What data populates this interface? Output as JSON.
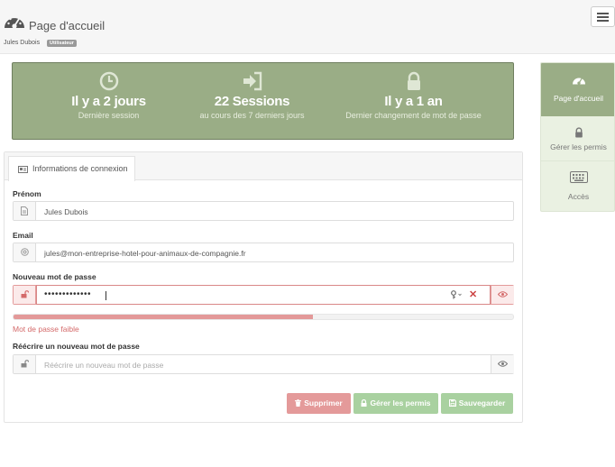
{
  "header": {
    "title": "Page d'accueil",
    "user_name": "Jules Dubois",
    "role_badge": "Utilisateur",
    "logo_icon": "dashboard-gauge-icon",
    "menu_icon": "hamburger-menu-icon"
  },
  "stats": [
    {
      "icon": "clock-icon",
      "value": "Il y a 2 jours",
      "caption": "Dernière session"
    },
    {
      "icon": "sign-in-icon",
      "value": "22 Sessions",
      "caption": "au cours des 7 derniers jours"
    },
    {
      "icon": "lock-icon",
      "value": "Il y a 1 an",
      "caption": "Dernier changement de mot de passe"
    }
  ],
  "sidebar": {
    "items": [
      {
        "label": "Page d'accueil",
        "icon": "dashboard-icon",
        "active": true
      },
      {
        "label": "Gérer les permis",
        "icon": "lock-icon",
        "active": false
      },
      {
        "label": "Accès",
        "icon": "keyboard-icon",
        "active": false
      }
    ]
  },
  "tab": {
    "label": "Informations de connexion",
    "icon": "id-card-icon"
  },
  "form": {
    "firstname": {
      "label": "Prénom",
      "value": "Jules Dubois"
    },
    "email": {
      "label": "Email",
      "value": "jules@mon-entreprise-hotel-pour-animaux-de-compagnie.fr"
    },
    "new_password": {
      "label": "Nouveau mot de passe",
      "masked_value": "•••••••••••••"
    },
    "strength": {
      "fraction": 0.6,
      "text": "Mot de passe faible"
    },
    "repeat_password": {
      "label": "Réécrire un nouveau mot de passe",
      "placeholder": "Réécrire un nouveau mot de passe"
    }
  },
  "buttons": {
    "delete": "Supprimer",
    "permissions": "Gérer les permis",
    "save": "Sauvegarder"
  },
  "colors": {
    "accent_green": "#9aad86",
    "danger": "#e49a9a",
    "success": "#a9d1a0"
  }
}
